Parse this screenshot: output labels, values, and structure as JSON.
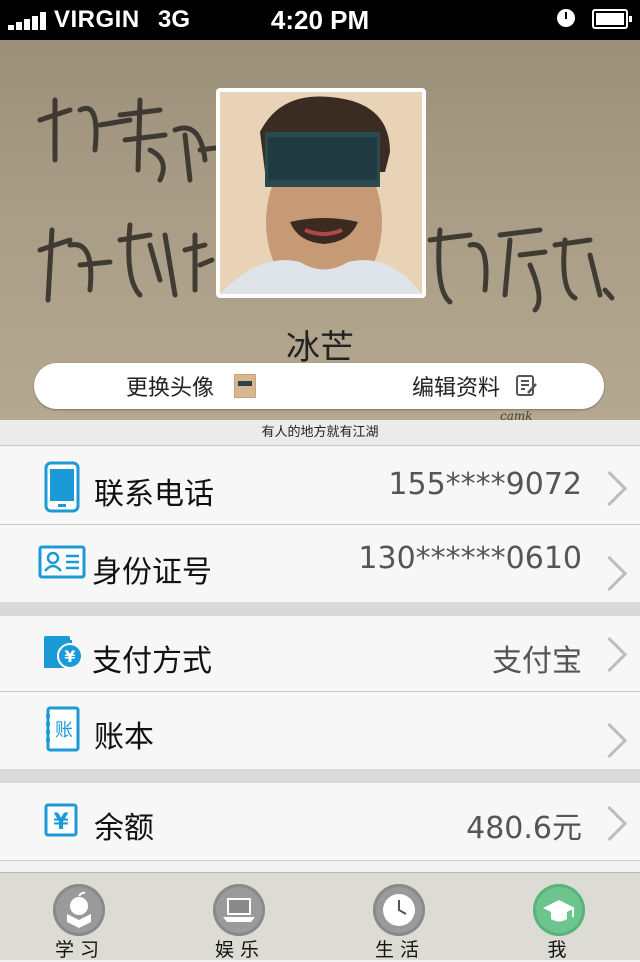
{
  "status_bar": {
    "carrier": "VIRGIN",
    "network": "3G",
    "time": "4:20 PM"
  },
  "profile": {
    "username": "冰芒",
    "change_avatar_label": "更换头像",
    "edit_profile_label": "编辑资料",
    "motto": "有人的地方就有江湖"
  },
  "rows": {
    "phone": {
      "label": "联系电话",
      "value": "155****9072"
    },
    "id_number": {
      "label": "身份证号",
      "value": "130******0610"
    },
    "payment": {
      "label": "支付方式",
      "value": "支付宝"
    },
    "ledger": {
      "label": "账本",
      "value": ""
    },
    "balance": {
      "label": "余额",
      "value": "480.6元"
    }
  },
  "tabs": [
    {
      "label": "学习",
      "icon": "apple-book-icon",
      "active": false
    },
    {
      "label": "娱乐",
      "icon": "laptop-icon",
      "active": false
    },
    {
      "label": "生活",
      "icon": "clock-icon",
      "active": false
    },
    {
      "label": "我",
      "icon": "graduation-cap-icon",
      "active": true
    }
  ],
  "colors": {
    "accent_blue": "#1a9ad6",
    "active_tab": "#6cc58c"
  }
}
